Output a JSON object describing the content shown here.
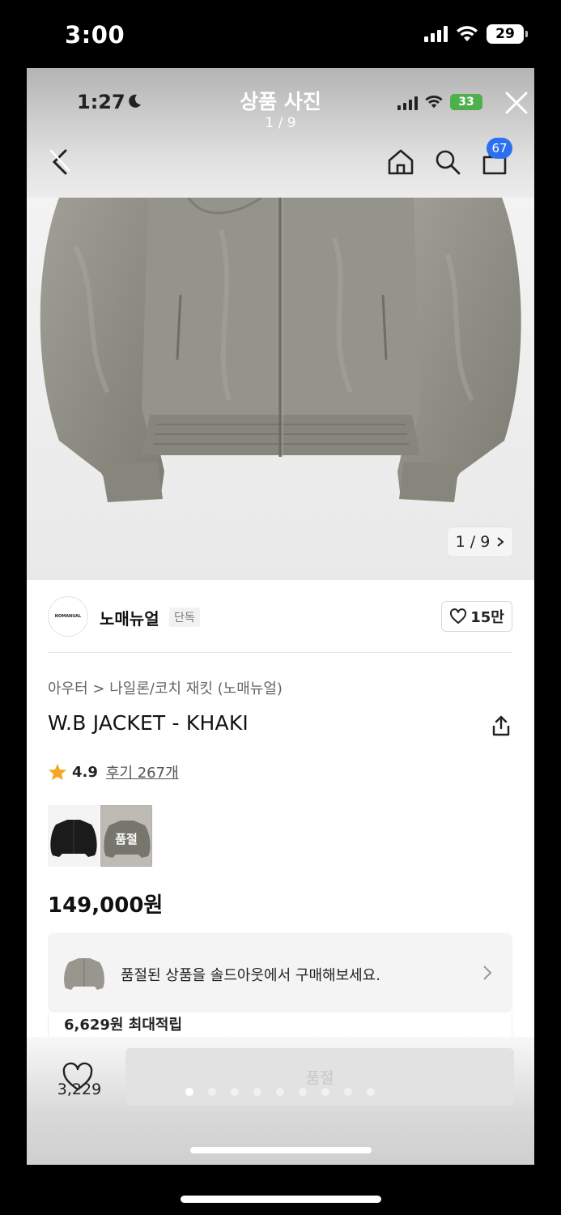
{
  "outer_status": {
    "time": "3:00",
    "battery": "29"
  },
  "viewer": {
    "inner_time": "1:27",
    "title": "상품 사진",
    "counter": "1 / 9",
    "inner_battery": "33"
  },
  "nav": {
    "cart_count": "67"
  },
  "image": {
    "counter": "1 / 9",
    "current_index": 1,
    "total": 9
  },
  "brand": {
    "logo_text": "NOMANUAL",
    "name": "노매뉴얼",
    "tag": "단독",
    "likes": "15만"
  },
  "product": {
    "breadcrumb": "아우터 > 나일론/코치 재킷 (노매뉴얼)",
    "title": "W.B JACKET - KHAKI",
    "rating": "4.9",
    "reviews": "후기 267개",
    "soldout_label": "품절",
    "price": "149,000원"
  },
  "promo": {
    "text": "품절된 상품을 솔드아웃에서 구매해보세요.",
    "points": "6,629원 최대적립"
  },
  "bottom": {
    "wish_count": "3,229",
    "buy_label": "품절",
    "dots_total": 9,
    "dots_active": 0
  },
  "colors": {
    "accent": "#2c6ff0",
    "star": "#f5a623",
    "jacket_khaki": "#8f8e84",
    "jacket_black": "#1b1b1c"
  }
}
